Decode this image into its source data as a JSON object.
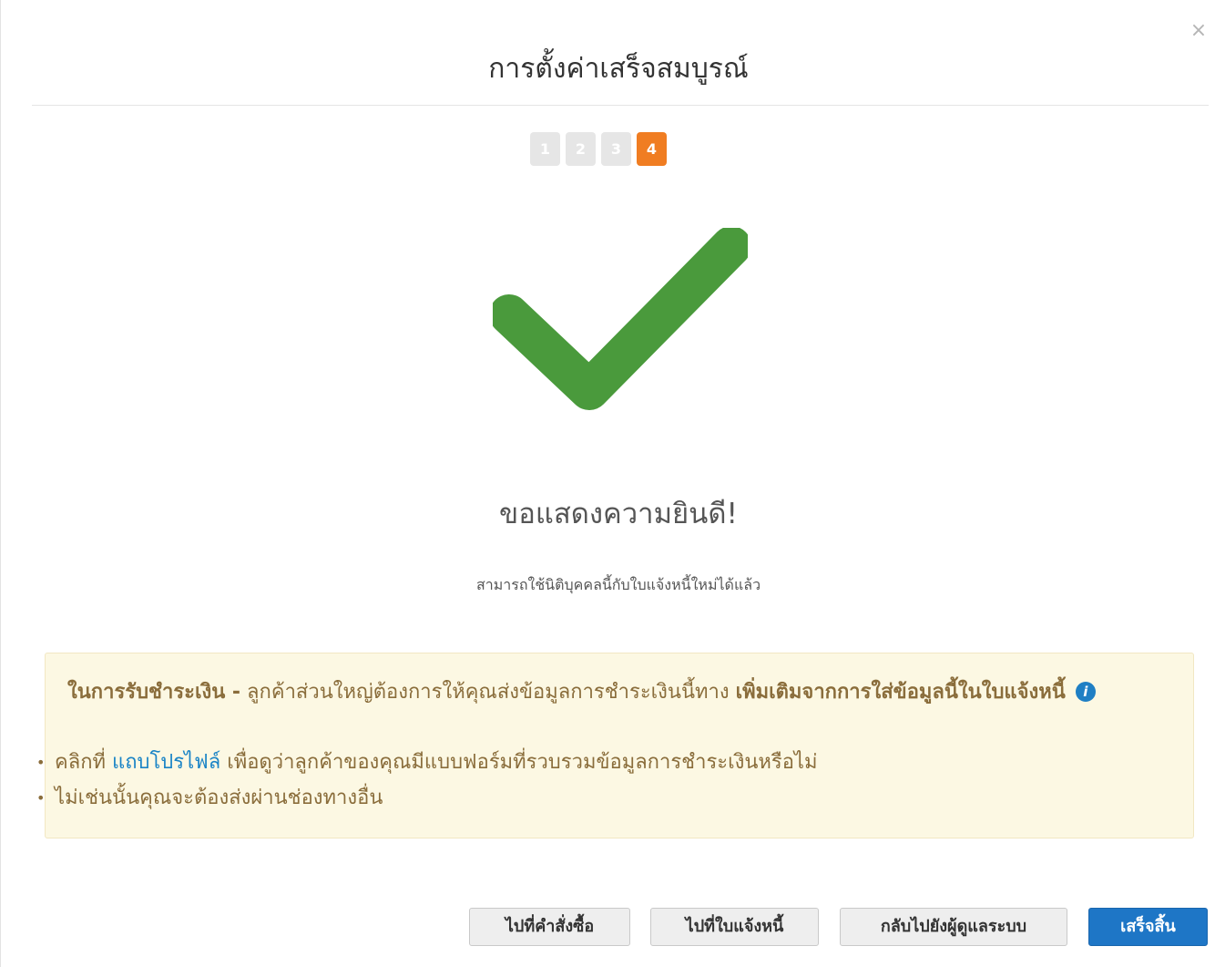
{
  "dialog": {
    "close_symbol": "×",
    "title": "การตั้งค่าเสร็จสมบูรณ์"
  },
  "steps": [
    {
      "label": "1",
      "active": false
    },
    {
      "label": "2",
      "active": false
    },
    {
      "label": "3",
      "active": false
    },
    {
      "label": "4",
      "active": true
    }
  ],
  "success": {
    "icon": "checkmark-icon",
    "icon_color": "#4a9a3c",
    "heading": "ขอแสดงความยินดี!",
    "message": "สามารถใช้นิติบุคคลนี้กับใบแจ้งหนี้ใหม่ได้แล้ว"
  },
  "info": {
    "bold_lead": "ในการรับชำระเงิน -",
    "text_mid": " ลูกค้าส่วนใหญ่ต้องการให้คุณส่งข้อมูลการชำระเงินนี้ทาง ",
    "bold_tail": "เพิ่มเติมจากการใส่ข้อมูลนี้ในใบแจ้งหนี้",
    "info_icon": "i",
    "bullet1_prefix": "คลิกที่ ",
    "bullet1_link": "แถบโปรไฟล์",
    "bullet1_suffix": " เพื่อดูว่าลูกค้าของคุณมีแบบฟอร์มที่รวบรวมข้อมูลการชำระเงินหรือไม่",
    "bullet2": "ไม่เช่นนั้นคุณจะต้องส่งผ่านช่องทางอื่น"
  },
  "buttons": {
    "purchase_orders": "ไปที่คำสั่งซื้อ",
    "invoices": "ไปที่ใบแจ้งหนี้",
    "back_to_admin": "กลับไปยังผู้ดูแลระบบ",
    "finish": "เสร็จสิ้น"
  },
  "colors": {
    "accent_step": "#f07d22",
    "primary_button": "#1e76c6",
    "link": "#1a84c6",
    "warning_bg": "#fcf8e3"
  }
}
